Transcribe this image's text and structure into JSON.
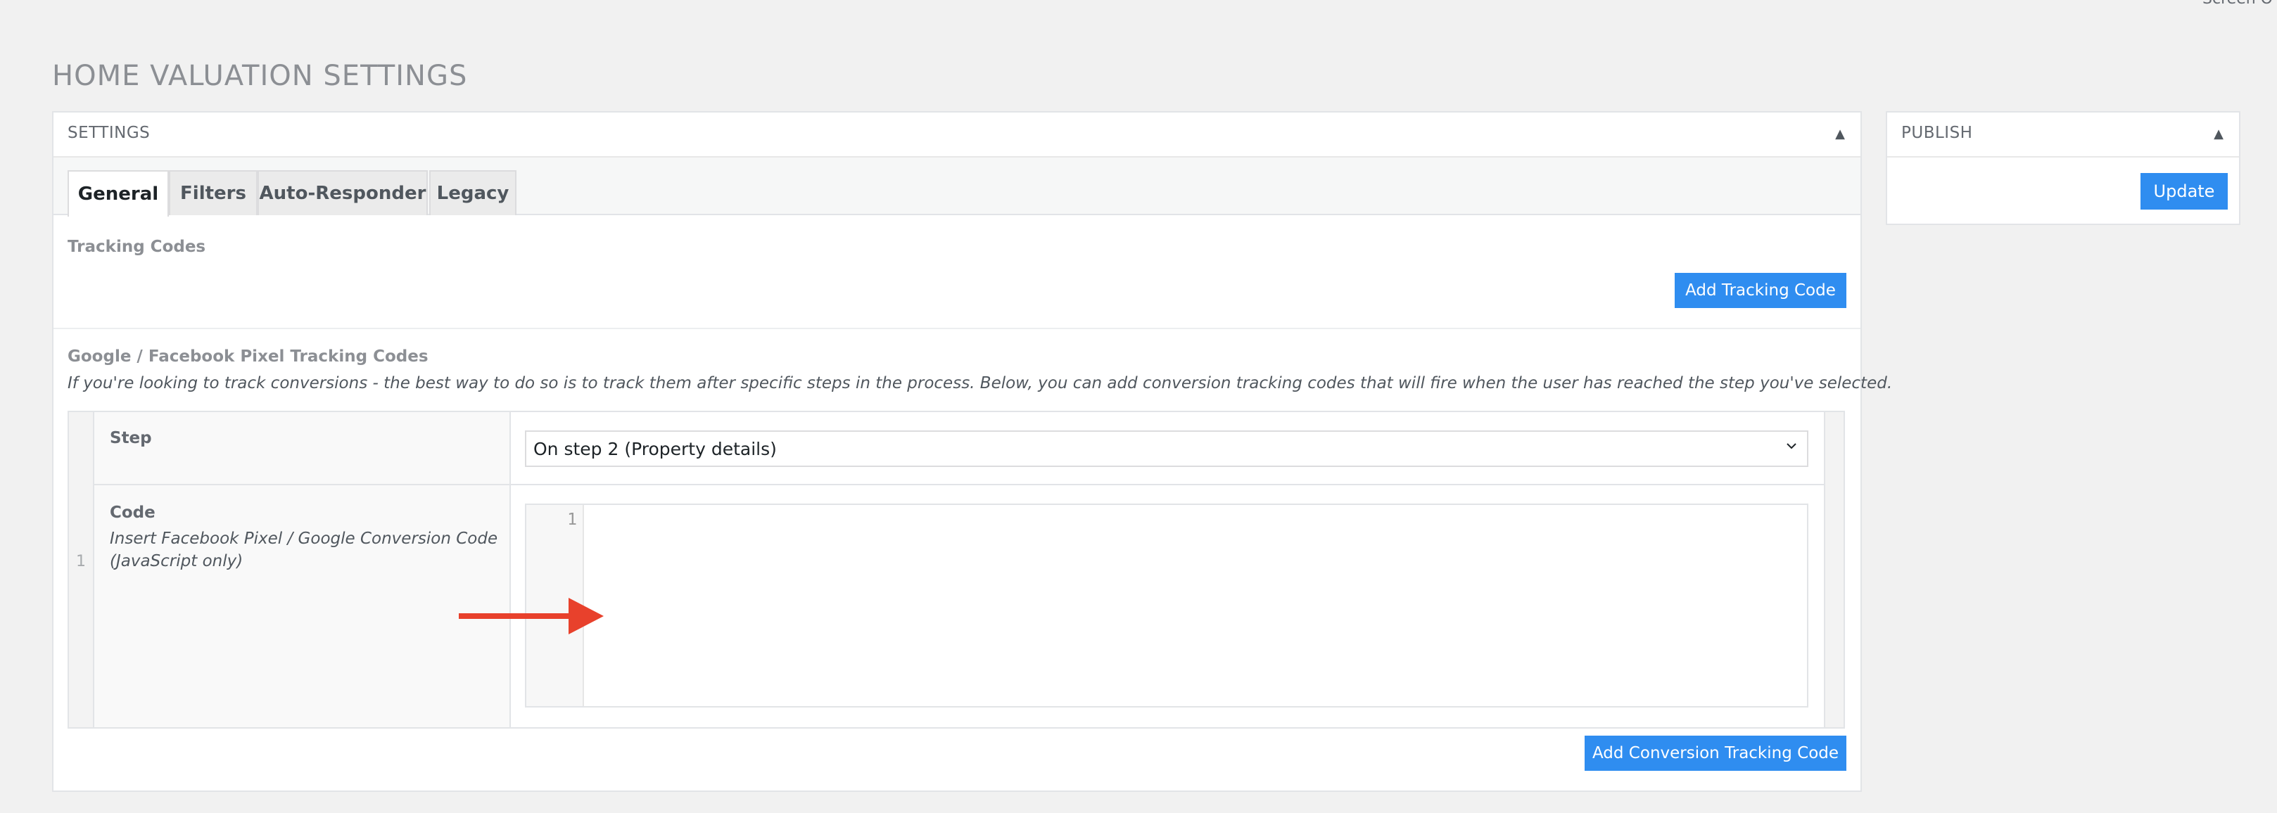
{
  "screen_options": "Screen O",
  "page_title": "HOME VALUATION SETTINGS",
  "settings_box": {
    "title": "SETTINGS",
    "tabs": [
      {
        "label": "General"
      },
      {
        "label": "Filters"
      },
      {
        "label": "Auto-Responder"
      },
      {
        "label": "Legacy"
      }
    ],
    "tracking_codes": {
      "label": "Tracking Codes",
      "add_button": "Add Tracking Code"
    },
    "pixel_section": {
      "label": "Google / Facebook Pixel Tracking Codes",
      "description": "If you're looking to track conversions - the best way to do so is to track them after specific steps in the process. Below, you can add conversion tracking codes that will fire when the user has reached the step you've selected.",
      "row_number": "1",
      "step_label": "Step",
      "step_value": "On step 2 (Property details)",
      "code_label": "Code",
      "code_desc": "Insert Facebook Pixel / Google Conversion Code (JavaScript only)",
      "editor_line": "1",
      "add_button": "Add Conversion Tracking Code"
    }
  },
  "publish_box": {
    "title": "PUBLISH",
    "update_button": "Update"
  },
  "colors": {
    "primary_button": "#2f8df0",
    "annotation_arrow": "#e8412c"
  },
  "icons": {
    "collapse": "triangle-up-icon",
    "select": "chevron-down-icon",
    "annotation": "arrow-right-icon"
  }
}
